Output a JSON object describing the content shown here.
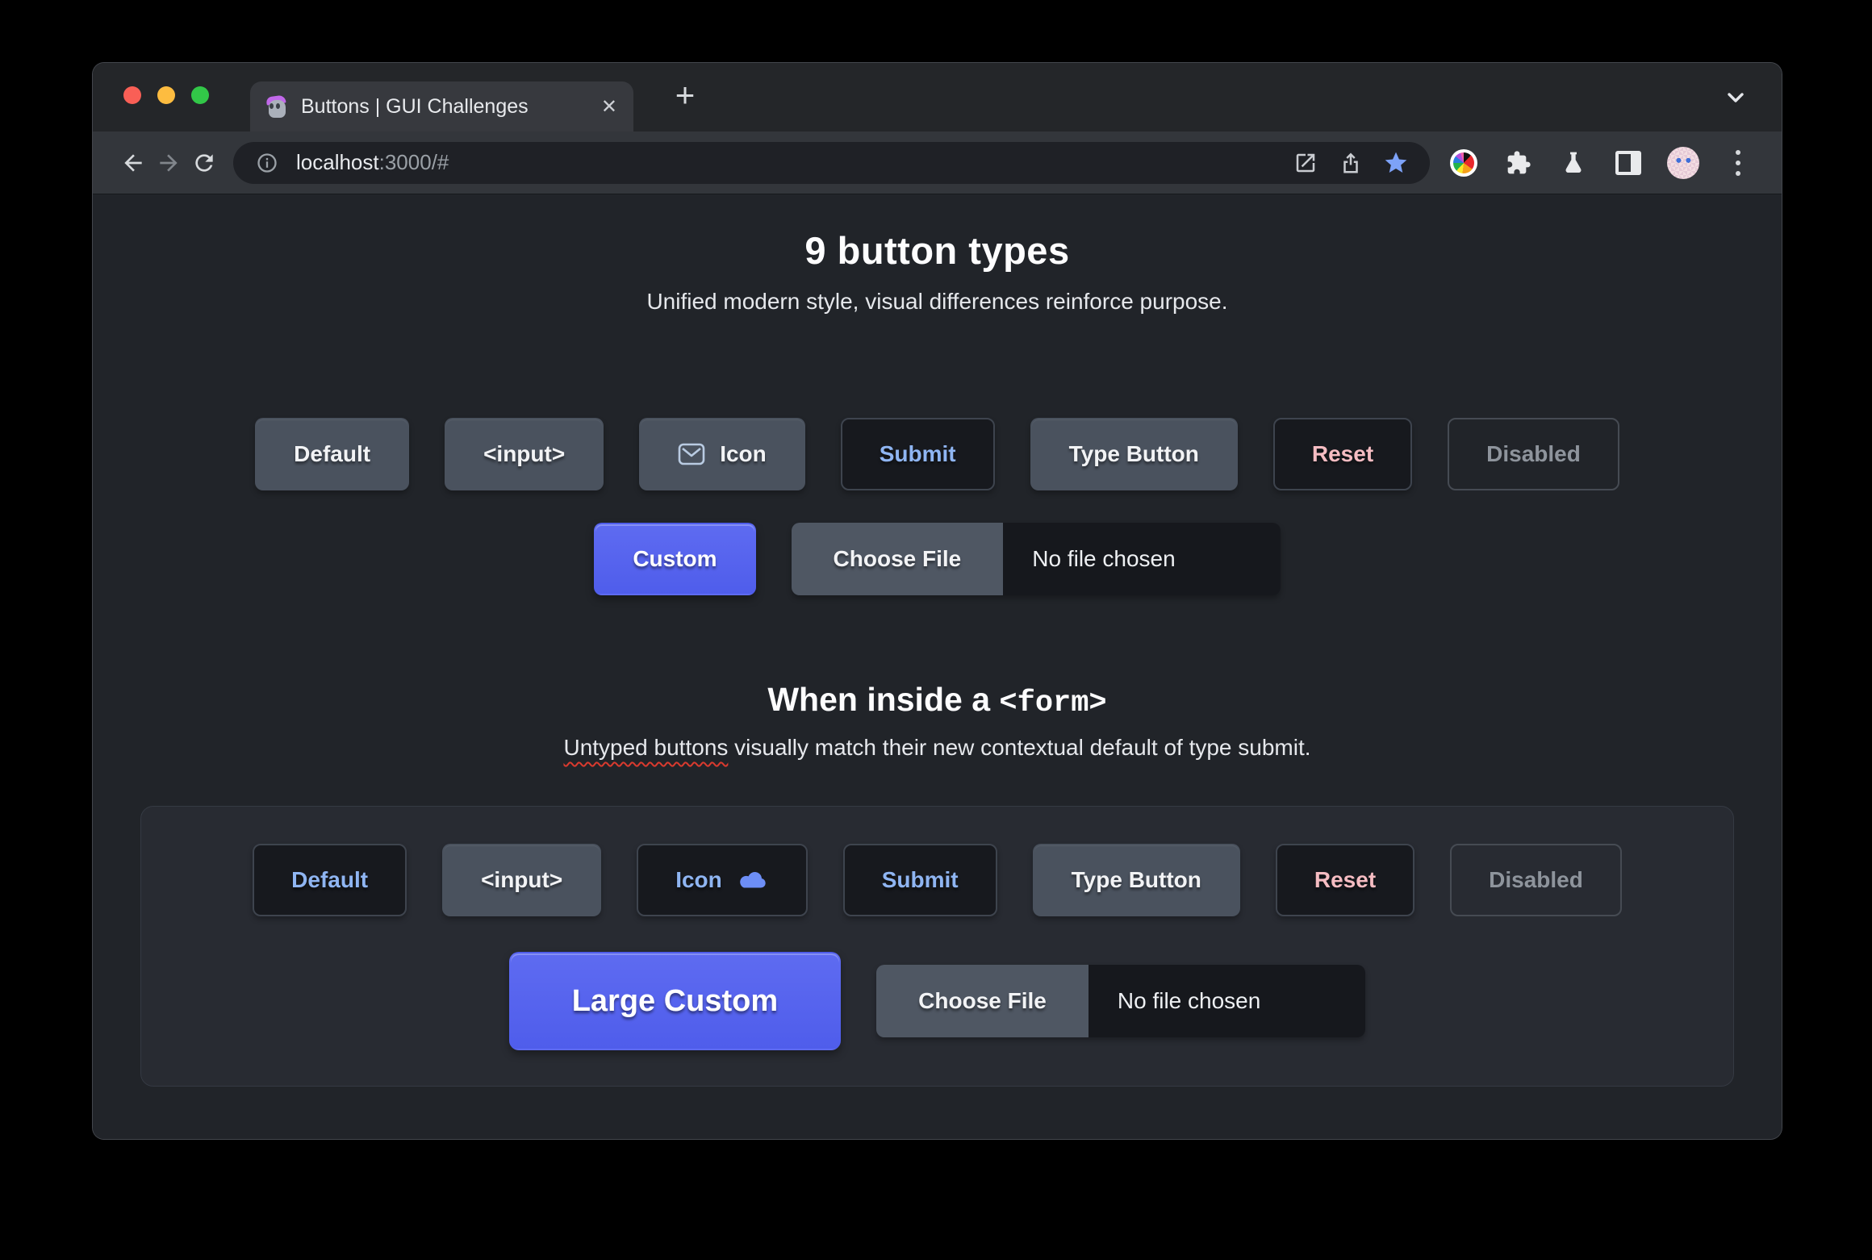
{
  "browser": {
    "window_controls": {
      "close": "close",
      "minimize": "minimize",
      "zoom": "zoom"
    },
    "tab": {
      "title": "Buttons | GUI Challenges",
      "close_glyph": "✕",
      "favicon": "skull-with-purple-cap"
    },
    "new_tab_glyph": "+",
    "url": {
      "host": "localhost",
      "path": ":3000/#"
    },
    "toolbar_icons": [
      "back-icon",
      "forward-icon",
      "reload-icon",
      "site-info-icon",
      "open-in-new-icon",
      "share-icon",
      "bookmark-star-icon",
      "colorwheel-extension-icon",
      "extensions-puzzle-icon",
      "experiments-flask-icon",
      "side-panel-icon",
      "profile-avatar",
      "menu-dots-icon"
    ]
  },
  "page": {
    "hero": {
      "title": "9 button types",
      "subtitle": "Unified modern style, visual differences reinforce purpose."
    },
    "buttons_row": [
      {
        "label": "Default"
      },
      {
        "label": "<input>"
      },
      {
        "label": "Icon",
        "icon": "envelope-icon"
      },
      {
        "label": "Submit"
      },
      {
        "label": "Type Button"
      },
      {
        "label": "Reset"
      },
      {
        "label": "Disabled"
      }
    ],
    "custom_label": "Custom",
    "file": {
      "button": "Choose File",
      "status": "No file chosen"
    },
    "form_section": {
      "heading_text": "When inside a",
      "heading_code": "<form>",
      "note_highlight": "Untyped buttons",
      "note_rest": " visually match their new contextual default of type submit.",
      "buttons_row": [
        {
          "label": "Default"
        },
        {
          "label": "<input>"
        },
        {
          "label": "Icon",
          "icon": "cloud-icon"
        },
        {
          "label": "Submit"
        },
        {
          "label": "Type Button"
        },
        {
          "label": "Reset"
        },
        {
          "label": "Disabled"
        }
      ],
      "large_custom_label": "Large Custom",
      "file": {
        "button": "Choose File",
        "status": "No file chosen"
      }
    }
  },
  "colors": {
    "accent_blue_text": "#8fb5f2",
    "accent_pink_text": "#f5bcc2",
    "custom_indigo": "#5462ed",
    "bookmark_star": "#7da2f8",
    "page_background": "#212429",
    "card_background": "#282b32",
    "gray_button": "#4a525e",
    "dark_button": "#17191e"
  }
}
